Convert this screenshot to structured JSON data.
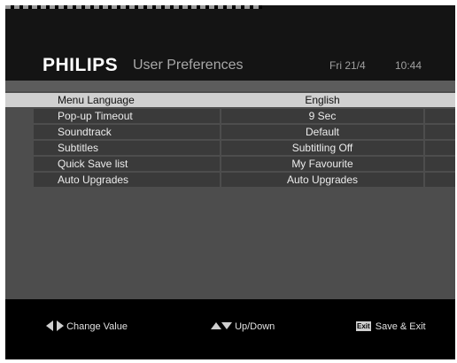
{
  "header": {
    "brand": "PHILIPS",
    "title": "User Preferences",
    "date": "Fri  21/4",
    "time": "10:44"
  },
  "menu": {
    "rows": [
      {
        "label": "Menu Language",
        "value": "English",
        "selected": true
      },
      {
        "label": "Pop-up Timeout",
        "value": "9 Sec"
      },
      {
        "label": "Soundtrack",
        "value": "Default"
      },
      {
        "label": "Subtitles",
        "value": "Subtitling Off"
      },
      {
        "label": "Quick Save list",
        "value": "My Favourite"
      },
      {
        "label": "Auto Upgrades",
        "value": "Auto Upgrades"
      }
    ]
  },
  "footer": {
    "change_value": "Change Value",
    "up_down": "Up/Down",
    "exit_key": "Exit",
    "save_exit": "Save & Exit"
  },
  "colors": {
    "screen_bg": "#000000",
    "panel_bg": "#4d4d4d",
    "row_bg": "#3a3a3a",
    "selected_row_bg": "#d0d0d0",
    "title_grey": "#a8a8a8"
  },
  "icons": {
    "change_value": "left-right-arrows-icon",
    "up_down": "up-down-arrows-icon",
    "exit": "exit-key-icon"
  }
}
